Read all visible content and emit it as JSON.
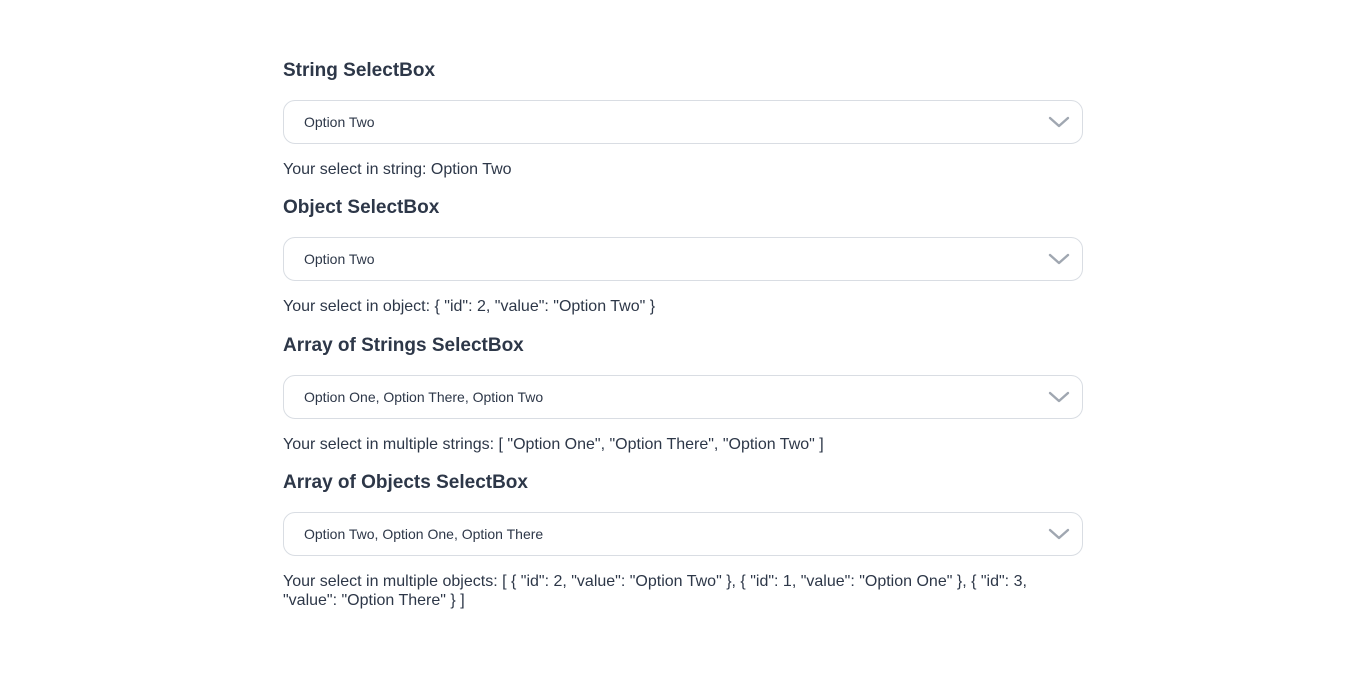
{
  "sections": [
    {
      "title": "String SelectBox",
      "selected_value": "Option Two",
      "result_text": "Your select in string: Option Two"
    },
    {
      "title": "Object SelectBox",
      "selected_value": "Option Two",
      "result_text": "Your select in object: { \"id\": 2, \"value\": \"Option Two\" }"
    },
    {
      "title": "Array of Strings SelectBox",
      "selected_value": "Option One, Option There, Option Two",
      "result_text": "Your select in multiple strings: [ \"Option One\", \"Option There\", \"Option Two\" ]"
    },
    {
      "title": "Array of Objects SelectBox",
      "selected_value": "Option Two, Option One, Option There",
      "result_text": "Your select in multiple objects: [ { \"id\": 2, \"value\": \"Option Two\" }, { \"id\": 1, \"value\": \"Option One\" }, { \"id\": 3, \"value\": \"Option There\" } ]"
    }
  ],
  "icons": {
    "dropdown": "chevron-down-icon"
  },
  "colors": {
    "text": "#2d3748",
    "border": "#d9dde3",
    "chevron": "#a0a7b1"
  }
}
